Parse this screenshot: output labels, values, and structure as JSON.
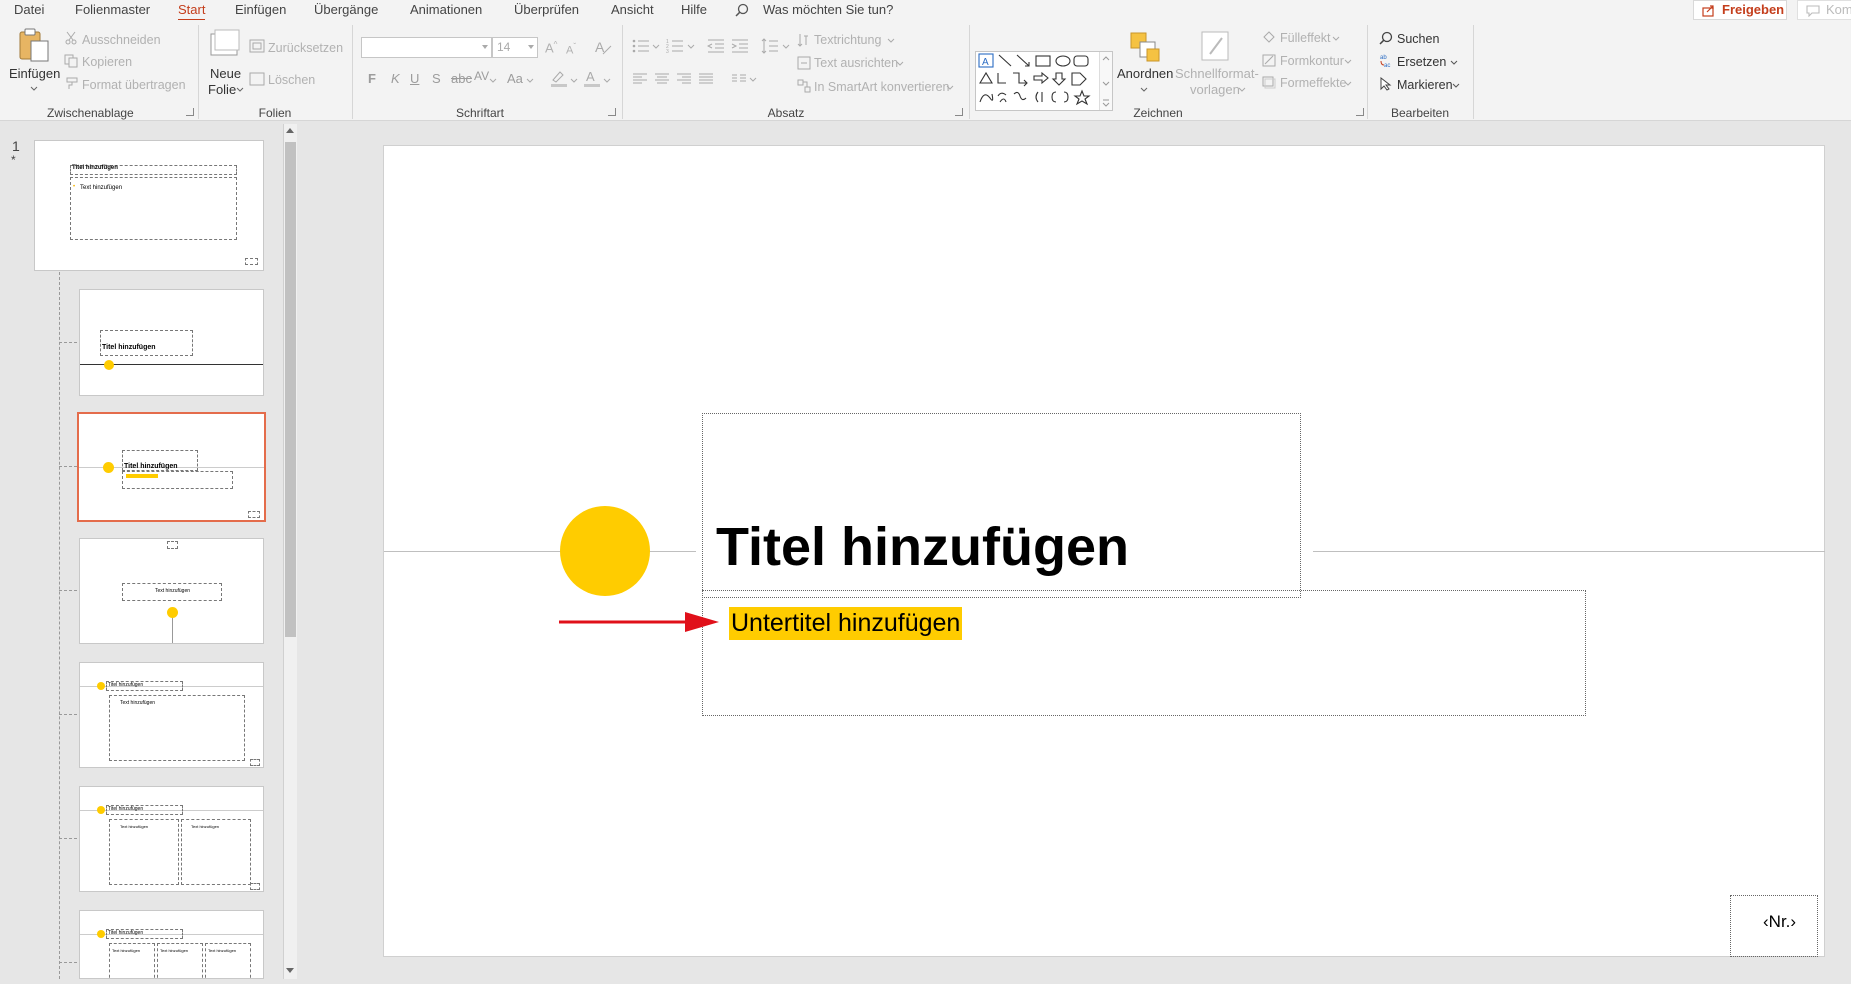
{
  "menu": {
    "tabs": [
      "Datei",
      "Folienmaster",
      "Start",
      "Einfügen",
      "Übergänge",
      "Animationen",
      "Überprüfen",
      "Ansicht",
      "Hilfe"
    ],
    "active_tab": "Start",
    "tell_me": "Was möchten Sie tun?",
    "share": "Freigeben",
    "comments": "Kommentare"
  },
  "ribbon": {
    "clipboard": {
      "label": "Zwischenablage",
      "paste": "Einfügen",
      "cut": "Ausschneiden",
      "copy": "Kopieren",
      "format_painter": "Format übertragen"
    },
    "slides": {
      "label": "Folien",
      "new_slide_line1": "Neue",
      "new_slide_line2": "Folie",
      "reset": "Zurücksetzen",
      "delete": "Löschen"
    },
    "font": {
      "label": "Schriftart",
      "font_name": "",
      "font_size": "14",
      "bold": "F",
      "italic": "K",
      "underline": "U",
      "strike": "S",
      "spacing": "AV",
      "case": "Aa"
    },
    "paragraph": {
      "label": "Absatz",
      "text_direction": "Textrichtung",
      "align_text": "Text ausrichten",
      "smartart": "In SmartArt konvertieren"
    },
    "drawing": {
      "label": "Zeichnen",
      "arrange": "Anordnen",
      "quick_styles_line1": "Schnellformat-",
      "quick_styles_line2": "vorlagen",
      "fill": "Fülleffekt",
      "outline": "Formkontur",
      "effects": "Formeffekte"
    },
    "editing": {
      "label": "Bearbeiten",
      "find": "Suchen",
      "replace": "Ersetzen",
      "select": "Markieren"
    }
  },
  "thumbnails": {
    "slide_number": "1",
    "star": "*",
    "master_title": "Titel hinzufügen",
    "master_text": "Text hinzufügen",
    "t2_title": "Titel hinzufügen",
    "t3_title": "Titel hinzufügen",
    "t4_text": "Text hinzufügen",
    "t5_title": "Titel hinzufügen",
    "t5_text": "Text hinzufügen",
    "t6_title": "Titel hinzufügen",
    "t6_text_a": "Text hinzufügen",
    "t6_text_b": "Text hinzufügen",
    "t7_title": "Titel hinzufügen",
    "t7_text_a": "Text hinzufügen",
    "t7_text_b": "Text hinzufügen",
    "t7_text_c": "Text hinzufügen"
  },
  "slide": {
    "title": "Titel hinzufügen",
    "subtitle": "Untertitel hinzufügen",
    "slide_number_placeholder": "‹Nr.›"
  },
  "colors": {
    "accent_yellow": "#ffcc00",
    "arrow_red": "#e0101a",
    "selection_border": "#e46c4b",
    "ribbon_active": "#c43e1c"
  }
}
